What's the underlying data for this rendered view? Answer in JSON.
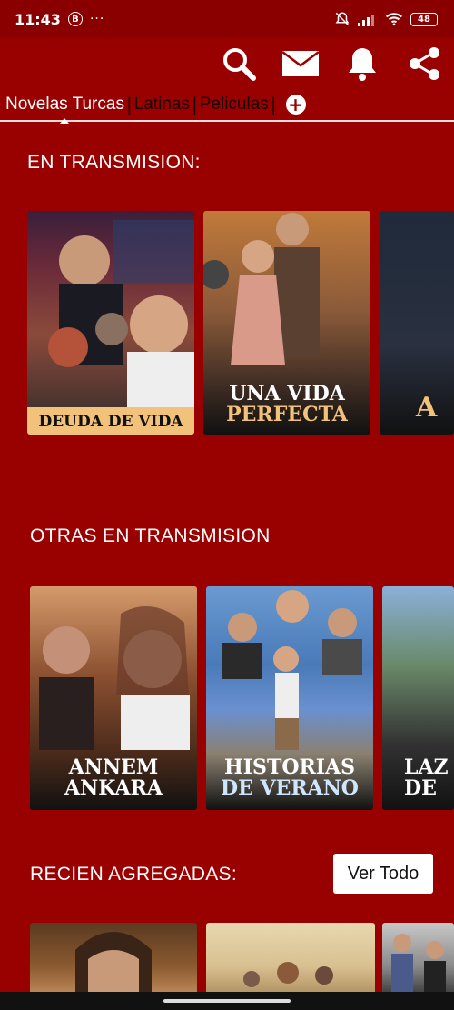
{
  "status_bar": {
    "time": "11:43",
    "badge": "B",
    "dots": "···",
    "battery": "48"
  },
  "toolbar": {
    "icons": [
      "search-icon",
      "mail-icon",
      "bell-icon",
      "share-icon"
    ]
  },
  "tabs": [
    {
      "label": "Novelas Turcas",
      "active": true
    },
    {
      "label": "Latinas",
      "active": false
    },
    {
      "label": "Peliculas",
      "active": false
    }
  ],
  "tab_add": "+",
  "sections": [
    {
      "title": "EN TRANSMISION:",
      "items": [
        {
          "caption": "DEUDA DE VIDA"
        },
        {
          "caption": "UNA VIDA PERFECTA",
          "line1": "UNA VIDA",
          "line2": "PERFECTA"
        },
        {
          "caption": "A"
        }
      ]
    },
    {
      "title": "OTRAS EN TRANSMISION",
      "items": [
        {
          "line1": "ANNEM",
          "line2": "ANKARA"
        },
        {
          "line1": "HISTORIAS",
          "line2": "DE VERANO"
        },
        {
          "line1": "LAZ",
          "line2": "DE"
        }
      ]
    },
    {
      "title": "RECIEN AGREGADAS:",
      "items": [
        {},
        {},
        {}
      ]
    }
  ],
  "ver_todo": "Ver Todo",
  "colors": {
    "background": "#990000",
    "status_bar": "#8a0000",
    "accent_gold": "#f3c27a"
  }
}
